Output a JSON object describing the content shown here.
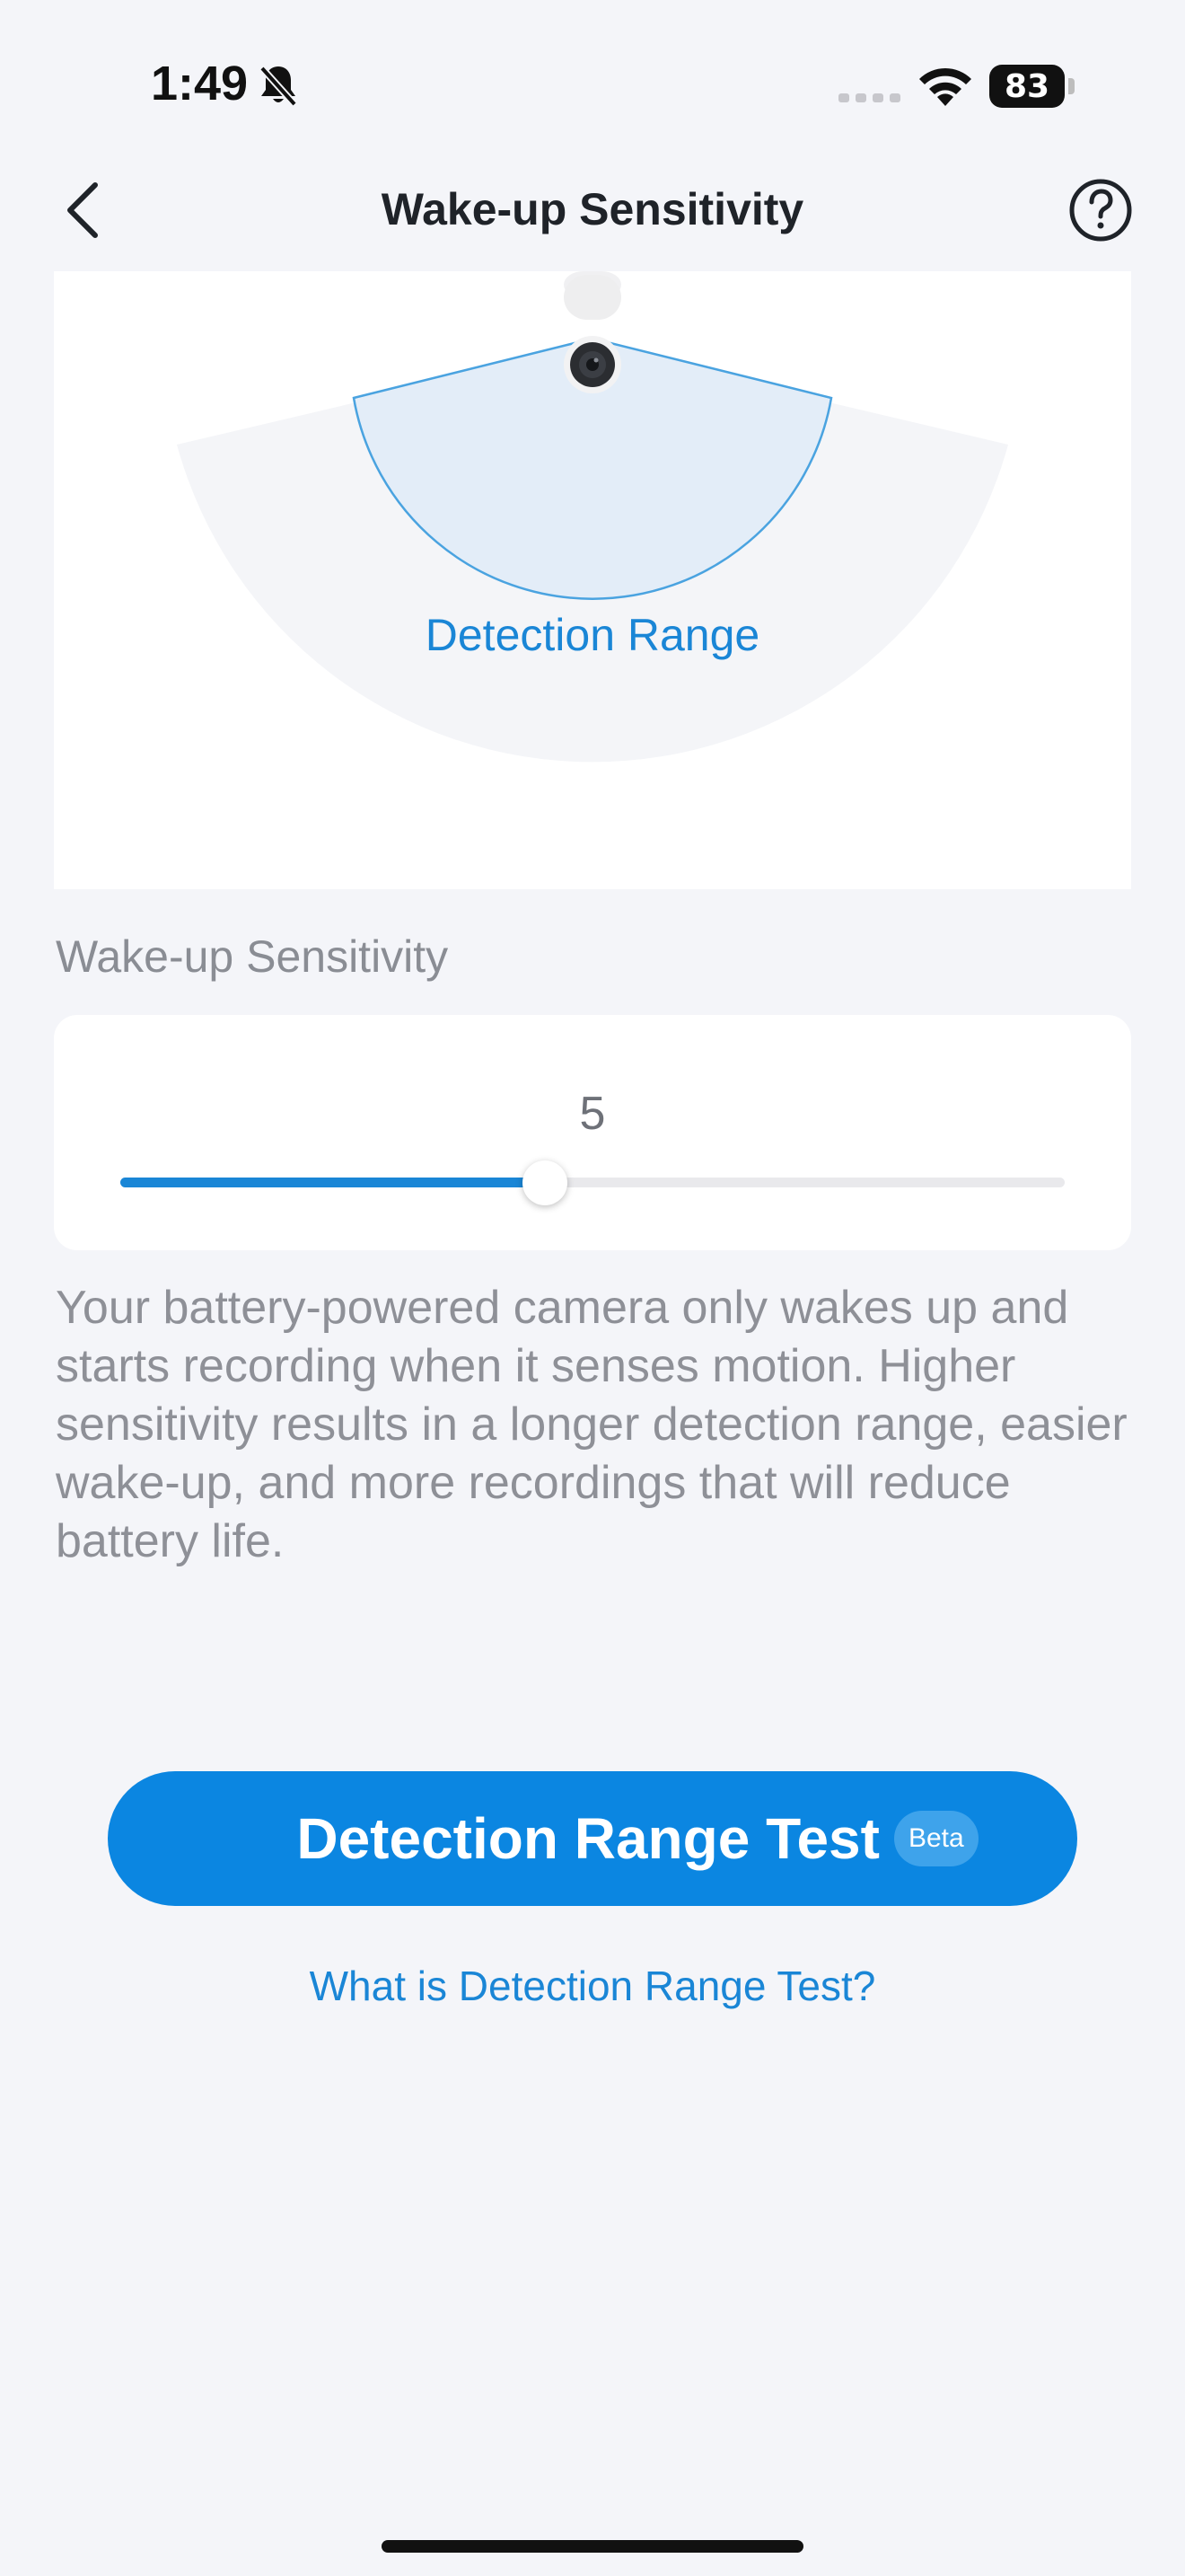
{
  "status_bar": {
    "time": "1:49",
    "battery_level": "83",
    "icons": [
      "bell-slash-icon",
      "cellular-signal-icon",
      "wifi-icon",
      "battery-icon"
    ]
  },
  "nav": {
    "title": "Wake-up Sensitivity",
    "back_icon": "chevron-left-icon",
    "help_icon": "question-circle-icon"
  },
  "illustration": {
    "range_label": "Detection Range",
    "range_color": "#1a86d6",
    "fill_color": "#e3edf8"
  },
  "sensitivity": {
    "section_label": "Wake-up Sensitivity",
    "value": "5",
    "level_fraction": 0.45,
    "accent": "#1a86d6"
  },
  "description": "Your battery-powered camera only wakes up and starts recording when it senses motion. Higher sensitivity results in a longer detection range, easier wake-up, and more recordings that will reduce battery life.",
  "cta": {
    "label": "Detection Range Test",
    "badge": "Beta",
    "color": "#0b86e1"
  },
  "help_link": "What is Detection Range Test?"
}
